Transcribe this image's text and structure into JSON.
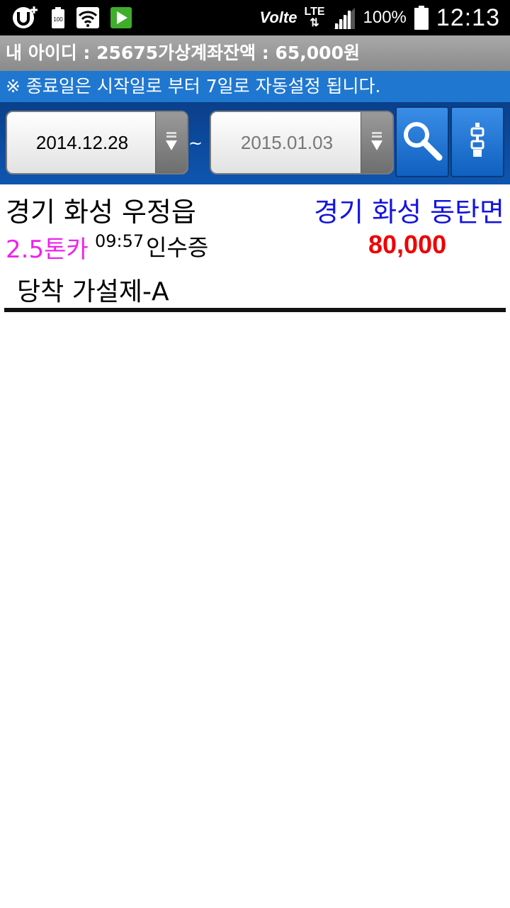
{
  "status_bar": {
    "battery": "100%",
    "time": "12:13",
    "network_label": "LTE",
    "volte_label": "Vo",
    "volte_suffix": "lte",
    "notification_battery_label": "100",
    "icons": [
      "u-plus-icon",
      "battery-notification-icon",
      "wifi-icon",
      "play-store-icon",
      "volte-icon",
      "lte-icon",
      "signal-icon",
      "battery-icon"
    ]
  },
  "account": {
    "text": "내 아이디 : 25675가상계좌잔액 : 65,000원"
  },
  "notice": {
    "text": "※ 종료일은 시작일로 부터 7일로 자동설정 됩니다."
  },
  "search": {
    "start_date": "2014.12.28",
    "end_date": "2015.01.03",
    "separator": "~",
    "accent_color": "#1f77d0"
  },
  "orders": [
    {
      "origin": "경기 화성 우정읍",
      "destination": "경기 화성 동탄면",
      "truck_type": "2.5톤카",
      "time": "09:57",
      "doc_type": "인수증",
      "price": "80,000",
      "note": "당착 가설제-A",
      "colors": {
        "destination": "#1414e0",
        "truck_type": "#ee22ee",
        "price": "#ee0000"
      }
    }
  ]
}
